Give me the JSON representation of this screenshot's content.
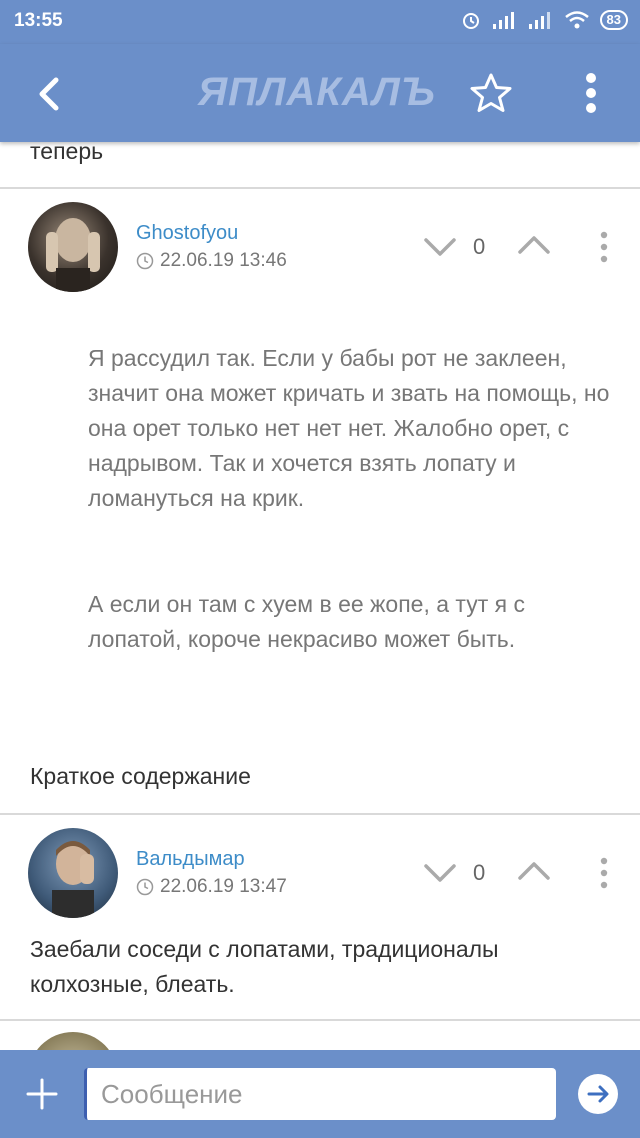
{
  "status_bar": {
    "time": "13:55",
    "battery": "83"
  },
  "header": {
    "logo": "ЯПЛАКАЛЪ",
    "back_icon": "chevron-left-icon",
    "star_icon": "star-icon",
    "more_icon": "more-vertical-icon"
  },
  "prev_text": "теперь",
  "posts": [
    {
      "username": "Ghostofyou",
      "timestamp": "22.06.19 13:46",
      "votes": "0",
      "quote_paragraphs": [
        "Я рассудил так. Если у бабы рот не заклеен, значит она может кричать и звать на помощь, но она орет только нет нет нет. Жалобно орет, с надрывом. Так и хочется взять лопату и ломануться на крик.",
        "А если он там с хуем в ее жопе, а тут я с лопатой, короче некрасиво может быть."
      ],
      "text": "Краткое содержание"
    },
    {
      "username": "Вальдымар",
      "timestamp": "22.06.19 13:47",
      "votes": "0",
      "text": "Заебали соседи с лопатами, традиционалы колхозные, блеать."
    }
  ],
  "composer": {
    "placeholder": "Сообщение"
  },
  "colors": {
    "bar": "#6b8fc9",
    "link": "#3d8cc8",
    "text": "#333333",
    "muted": "#777777"
  }
}
